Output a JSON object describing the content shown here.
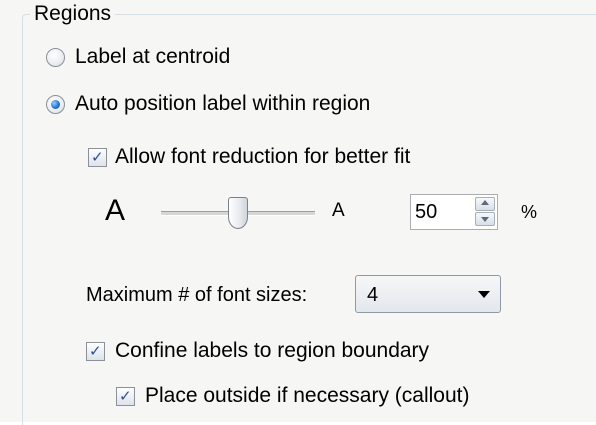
{
  "group": {
    "title": "Regions"
  },
  "radios": [
    {
      "label": "Label at centroid",
      "checked": false
    },
    {
      "label": "Auto position label within region",
      "checked": true
    }
  ],
  "font_reduction": {
    "label": "Allow font reduction for better fit",
    "checked": true,
    "big_a": "A",
    "small_a": "A",
    "percent_value": "50",
    "percent_symbol": "%",
    "slider_level_fraction": 0.5
  },
  "max_font_sizes": {
    "label": "Maximum # of font sizes:",
    "selected": "4"
  },
  "confine": {
    "label": "Confine labels to region boundary",
    "checked": true
  },
  "outside": {
    "label": "Place outside if necessary (callout)",
    "checked": true
  }
}
